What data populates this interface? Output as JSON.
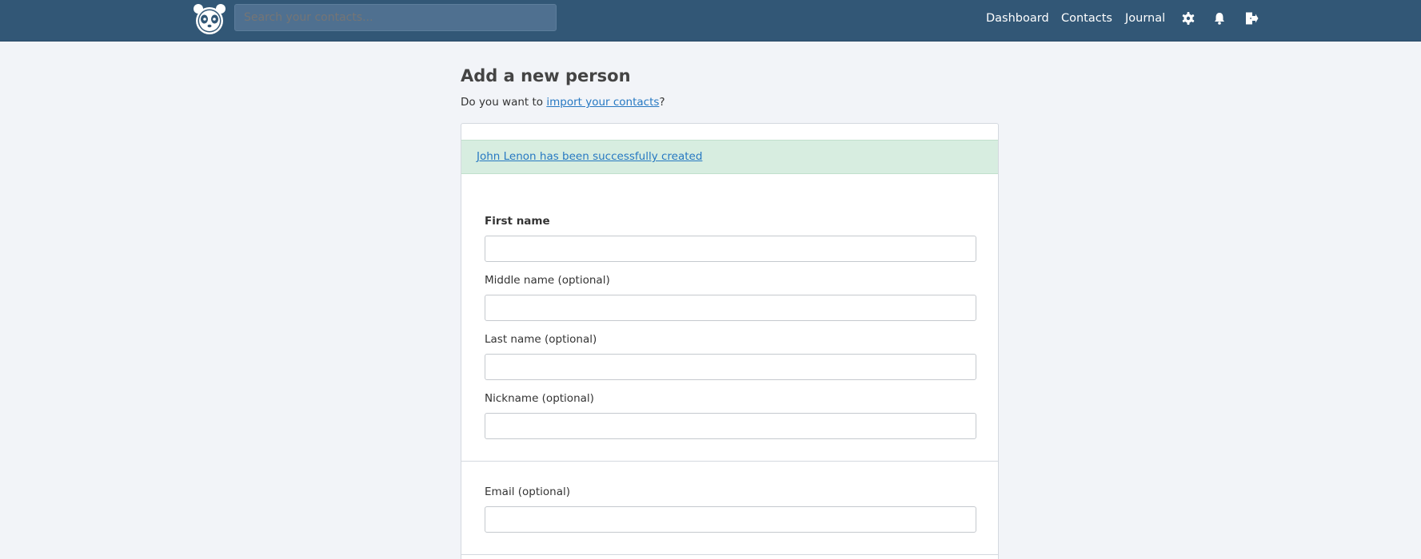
{
  "header": {
    "search_placeholder": "Search your contacts...",
    "nav": {
      "dashboard": "Dashboard",
      "contacts": "Contacts",
      "journal": "Journal"
    },
    "icons": [
      "panda-logo-icon",
      "gear-icon",
      "bell-icon",
      "logout-icon"
    ],
    "background_color": "#325776"
  },
  "page": {
    "title": "Add a new person",
    "import_prefix": "Do you want to ",
    "import_link": "import your contacts",
    "import_suffix": "?"
  },
  "alert": {
    "message": "John Lenon has been successfully created",
    "color": "#d7ede0"
  },
  "form": {
    "first_name_label": "First name",
    "middle_name_label": "Middle name (optional)",
    "last_name_label": "Last name (optional)",
    "nickname_label": "Nickname (optional)",
    "email_label": "Email (optional)",
    "first_name_value": "",
    "middle_name_value": "",
    "last_name_value": "",
    "nickname_value": "",
    "email_value": ""
  }
}
